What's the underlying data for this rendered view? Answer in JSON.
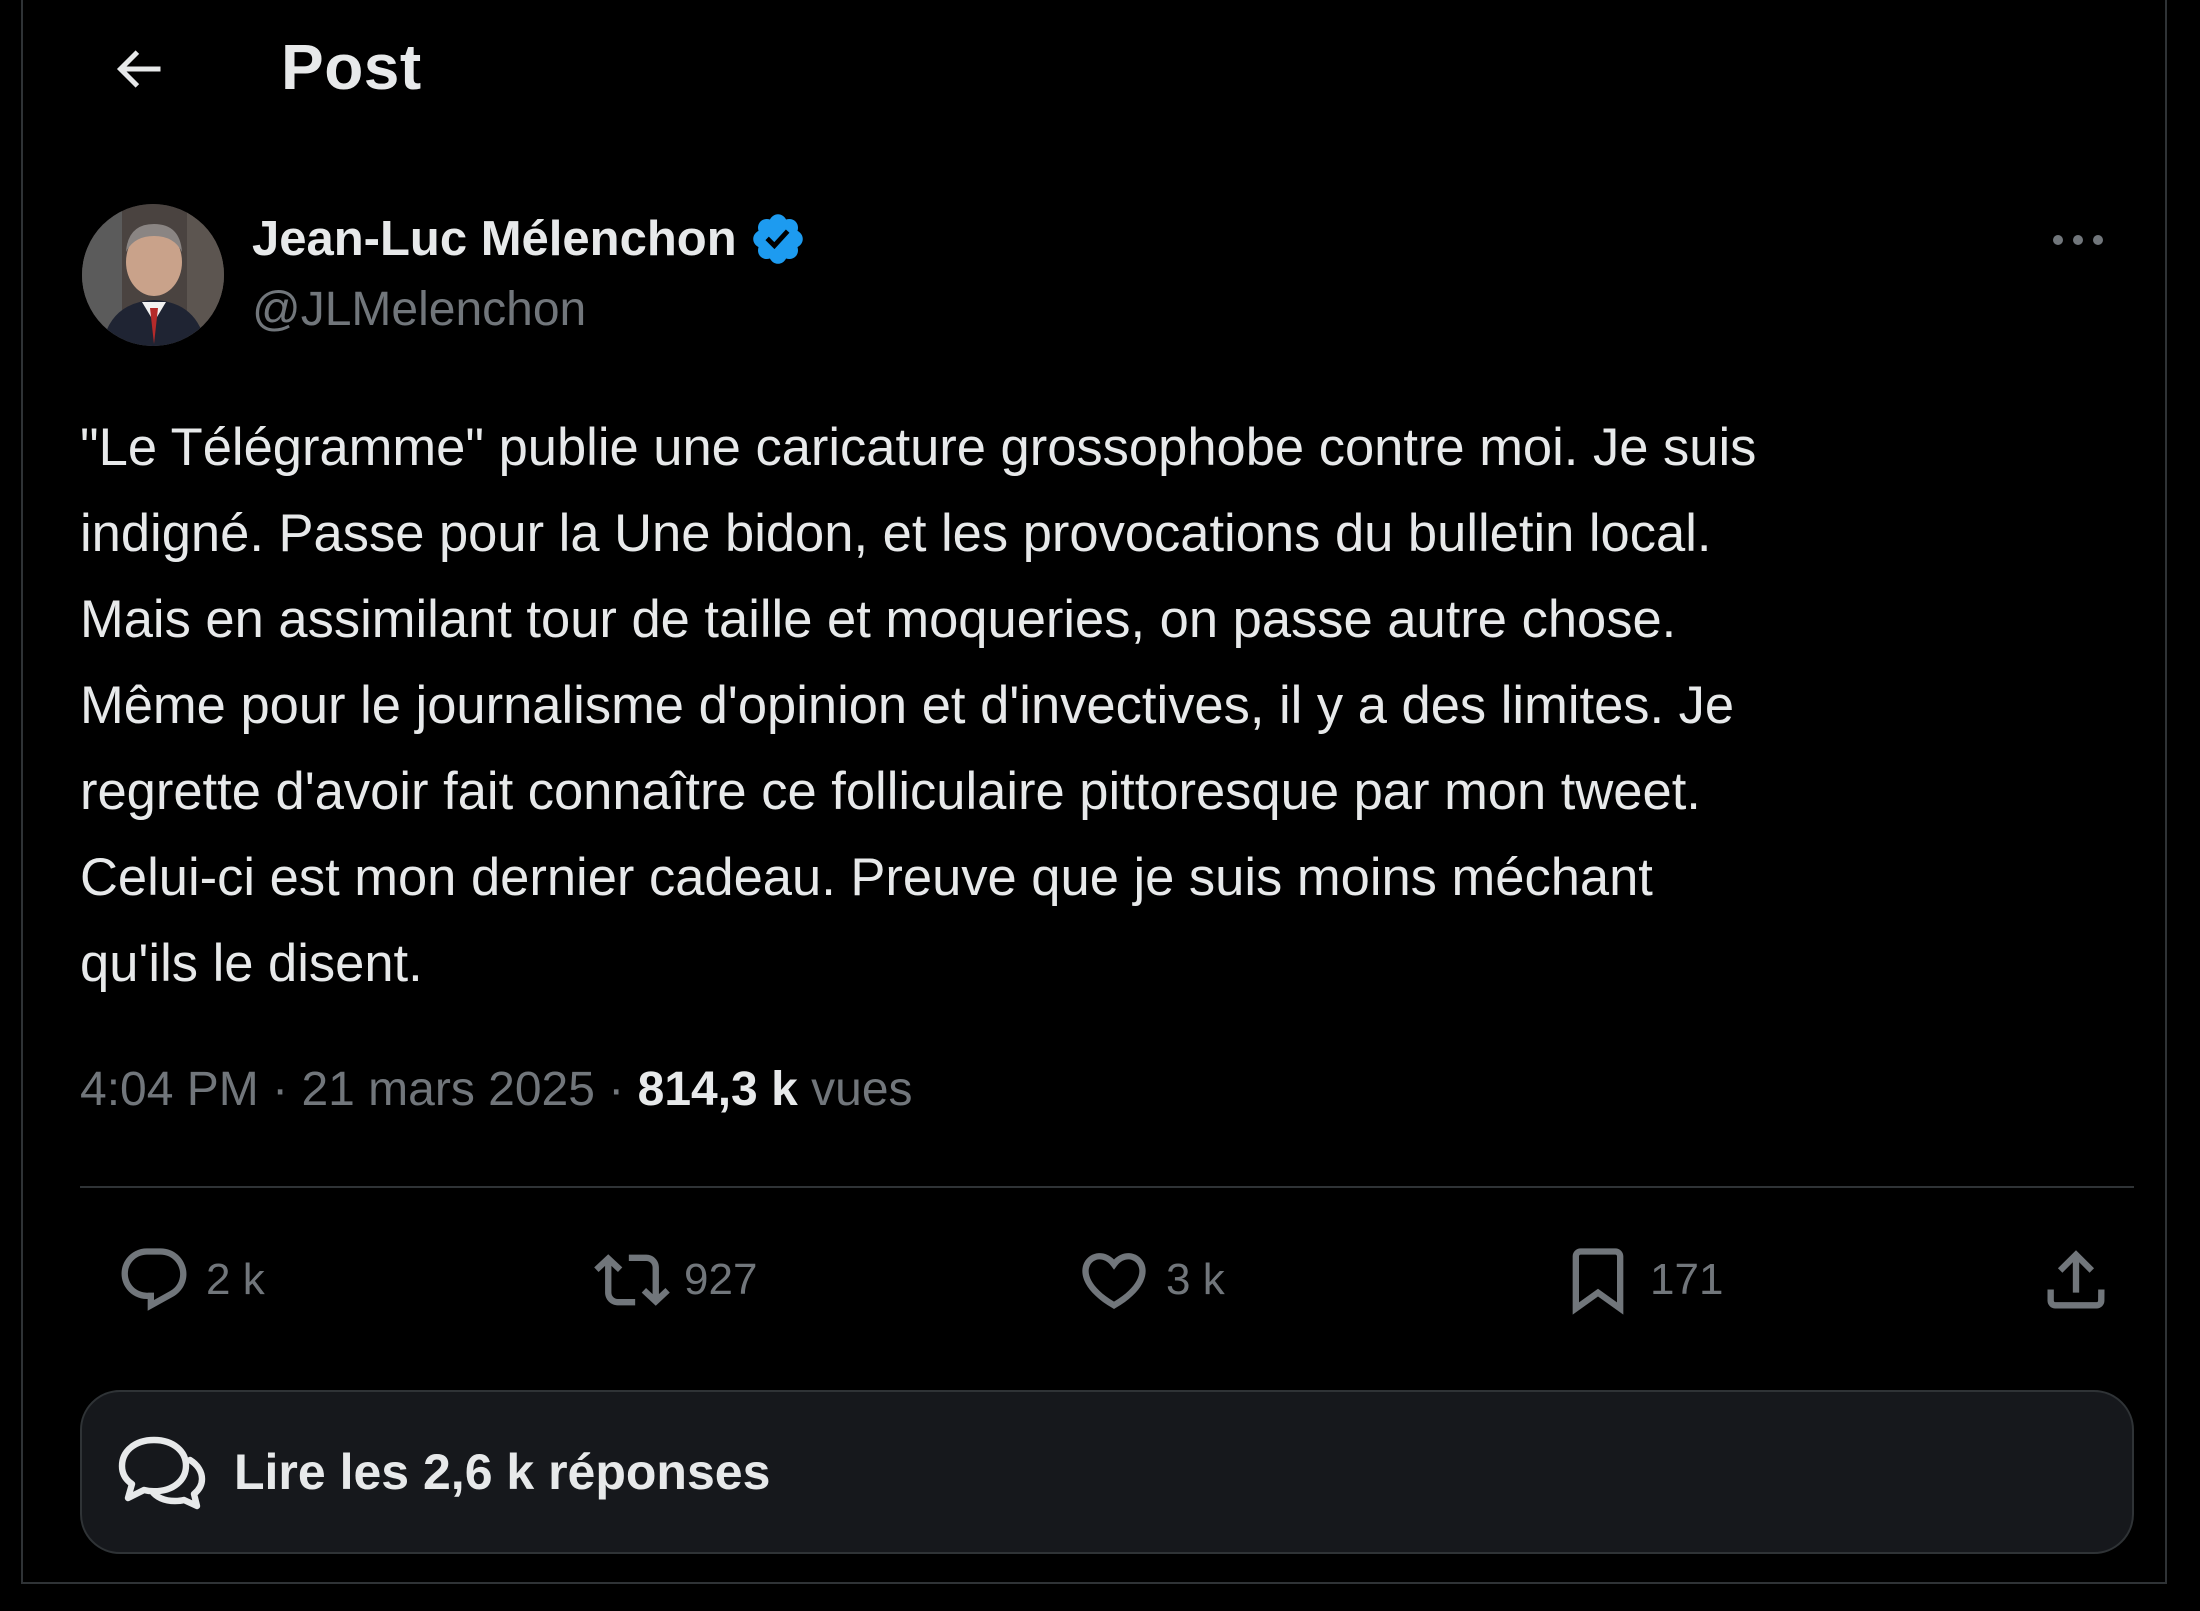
{
  "header": {
    "title": "Post"
  },
  "author": {
    "name": "Jean-Luc Mélenchon",
    "handle": "@JLMelenchon"
  },
  "tweet": {
    "lines": [
      "\"Le Télégramme\" publie une caricature grossophobe contre moi. Je suis",
      "indigné. Passe pour la Une bidon, et les provocations du bulletin local.",
      "Mais en assimilant tour de taille et moqueries, on passe autre chose.",
      "Même pour le journalisme d'opinion et d'invectives, il y a des limites. Je",
      "regrette d'avoir fait connaître ce folliculaire pittoresque par mon tweet.",
      "Celui-ci est mon dernier cadeau. Preuve que je suis moins méchant",
      "qu'ils le disent."
    ]
  },
  "meta": {
    "time": "4:04 PM",
    "separator": "·",
    "date": "21 mars 2025",
    "views_count": "814,3 k",
    "views_label": "vues"
  },
  "actions": {
    "replies": "2 k",
    "reposts": "927",
    "likes": "3 k",
    "bookmarks": "171"
  },
  "replies_button": {
    "label": "Lire les 2,6 k réponses"
  },
  "colors": {
    "background": "#000000",
    "text_primary": "#e7e9ea",
    "text_secondary": "#71767b",
    "border": "#2f3336",
    "verified": "#1d9bf0",
    "button_bg": "#16181c"
  }
}
